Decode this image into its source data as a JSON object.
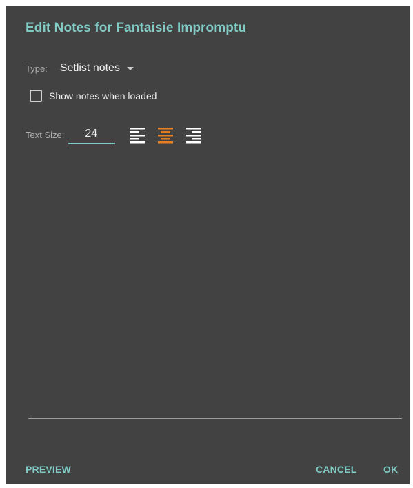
{
  "dialog": {
    "title": "Edit Notes for Fantaisie Impromptu"
  },
  "type": {
    "label": "Type:",
    "selected": "Setlist notes"
  },
  "show_notes": {
    "label": "Show notes when loaded",
    "checked": false
  },
  "text_size": {
    "label": "Text Size:",
    "value": "24"
  },
  "alignment": {
    "options": [
      "align-left",
      "align-center",
      "align-right"
    ],
    "selected": "align-center",
    "active_color": "#e67e22",
    "inactive_color": "#ffffff"
  },
  "footer": {
    "preview": "PREVIEW",
    "cancel": "CANCEL",
    "ok": "OK"
  },
  "colors": {
    "accent": "#80cbc4",
    "background": "#424242"
  }
}
